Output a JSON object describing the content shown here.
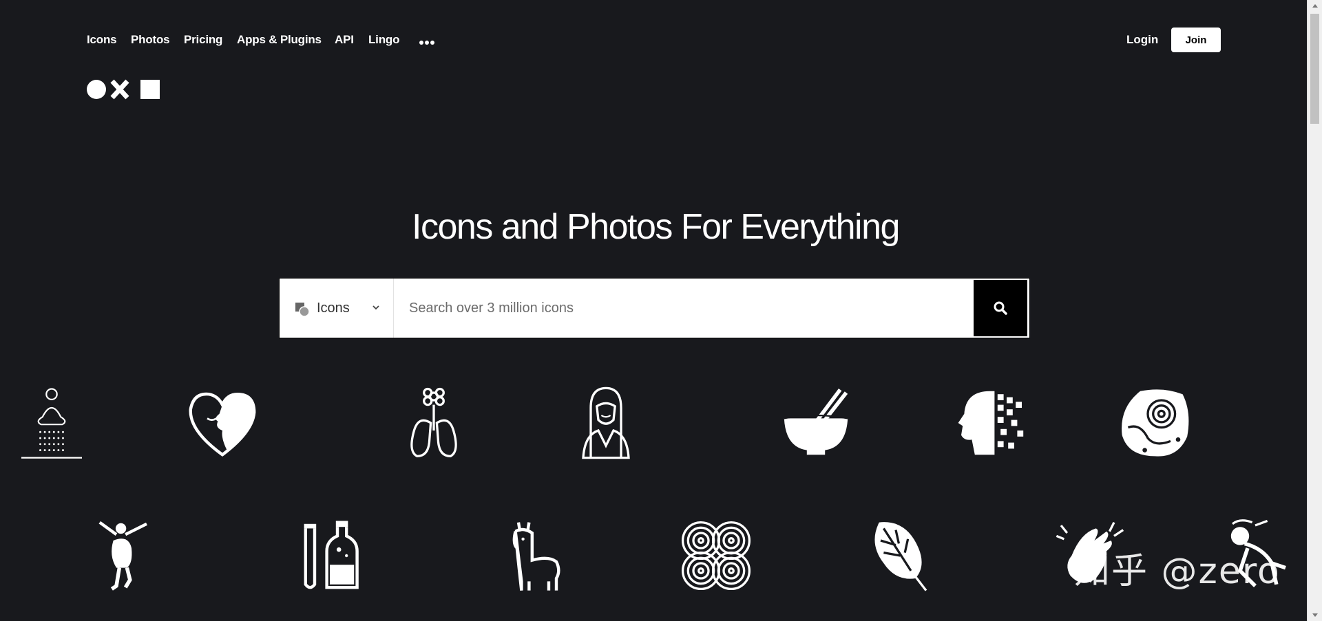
{
  "nav": {
    "links": [
      "Icons",
      "Photos",
      "Pricing",
      "Apps & Plugins",
      "API",
      "Lingo"
    ],
    "more_icon": "more-dots-icon",
    "login": "Login",
    "join": "Join"
  },
  "hero": {
    "title": "Icons and Photos For Everything"
  },
  "search": {
    "type_label": "Icons",
    "placeholder": "Search over 3 million icons",
    "button_icon": "search-icon"
  },
  "icons_row1": [
    "meditation-shower-icon",
    "heart-face-icon",
    "flower-lungs-icon",
    "woman-portrait-icon",
    "bowl-chopsticks-icon",
    "pixel-head-icon",
    "fossil-stone-icon"
  ],
  "icons_row2": [
    "dancer-icon",
    "test-tube-bottle-icon",
    "llama-icon",
    "swirl-pattern-icon",
    "monstera-leaf-icon",
    "clapping-hands-icon",
    "skydiver-icon"
  ],
  "watermark": "知乎 @zero",
  "colors": {
    "background": "#18191d",
    "search_button": "#000000",
    "join_bg": "#ffffff"
  }
}
